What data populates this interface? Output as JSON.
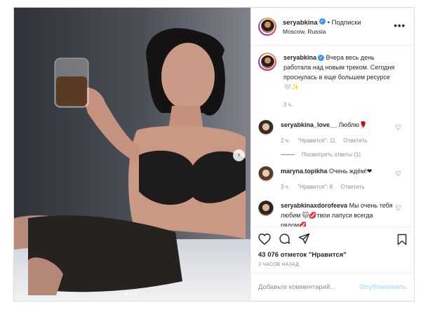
{
  "post": {
    "username": "seryabkina",
    "follow_label": "• Подписки",
    "location": "Moscow, Russia",
    "more_label": "•••"
  },
  "caption": {
    "username": "seryabkina",
    "text": "Вчера весь день работала над новым треком. Сегодня проснулась в еще большем ресурсе 🤍✨",
    "time": "3 ч."
  },
  "comments": [
    {
      "username": "seryabkina_love__",
      "text": "Люблю🌹",
      "time": "2 ч.",
      "likes": "\"Нравится\": 11",
      "reply": "Ответить"
    },
    {
      "username": "maryna.topikha",
      "text": "Очень ждём!❤",
      "time": "3 ч.",
      "likes": "\"Нравится\": 8",
      "reply": "Ответить"
    },
    {
      "username": "seryabkinaxdorofeeva",
      "text": "Мы очень тебя любим 🐱💋твои лапуси всегда рядом💋"
    }
  ],
  "replies_label": "Посмотреть ответы (1)",
  "likes_count": "43 076 отметок \"Нравится\"",
  "time_ago": "3 ЧАСОВ НАЗАД",
  "comment_input": {
    "placeholder": "Добавьте комментарий...",
    "publish_label": "Опубликовать"
  },
  "carousel": {
    "next_icon": "chevron-right-icon",
    "dots_total": 3,
    "active_dot": 1
  },
  "colors": {
    "verified": "#3897f0",
    "publish_disabled": "#b2dffc",
    "muted": "#8e8e8e"
  }
}
